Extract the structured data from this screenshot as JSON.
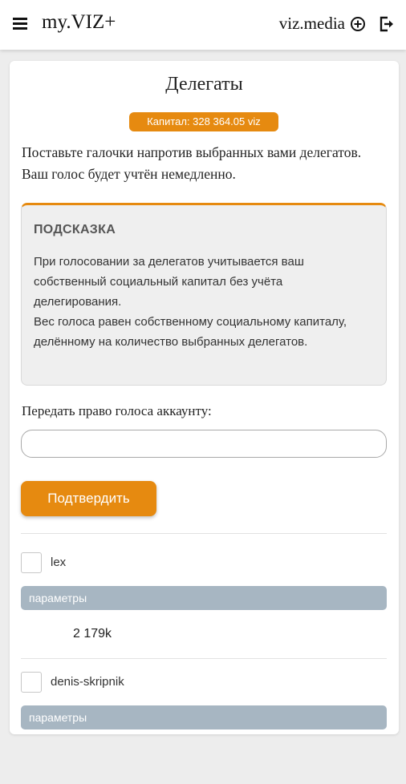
{
  "header": {
    "brand": "my.VIZ+",
    "link": "viz.media",
    "icons": [
      "menu-icon",
      "plus-circle-icon",
      "logout-icon"
    ]
  },
  "page": {
    "title": "Делегаты",
    "capital_badge": "Капитал: 328 364.05 viz",
    "intro": "Поставьте галочки напротив выбранных вами делегатов. Ваш голос будет учтён немедленно."
  },
  "hint": {
    "title": "ПОДСКАЗКА",
    "text_line1": "При голосовании за делегатов учитывается ваш собственный социальный капитал без учёта делегирования.",
    "text_line2": "Вес голоса равен собственному социальному капиталу, делённому на количество выбранных делегатов."
  },
  "delegate_form": {
    "label": "Передать право голоса аккаунту:",
    "input_value": "",
    "input_placeholder": "",
    "confirm_button": "Подтвердить"
  },
  "delegates": [
    {
      "name": "lex",
      "params_label": "параметры",
      "value": "2 179k",
      "checked": false
    },
    {
      "name": "denis-skripnik",
      "params_label": "параметры",
      "value": "",
      "checked": false
    }
  ],
  "colors": {
    "accent": "#e68a10",
    "params_bar": "#a7b6c2",
    "hint_bg": "#efefef"
  }
}
